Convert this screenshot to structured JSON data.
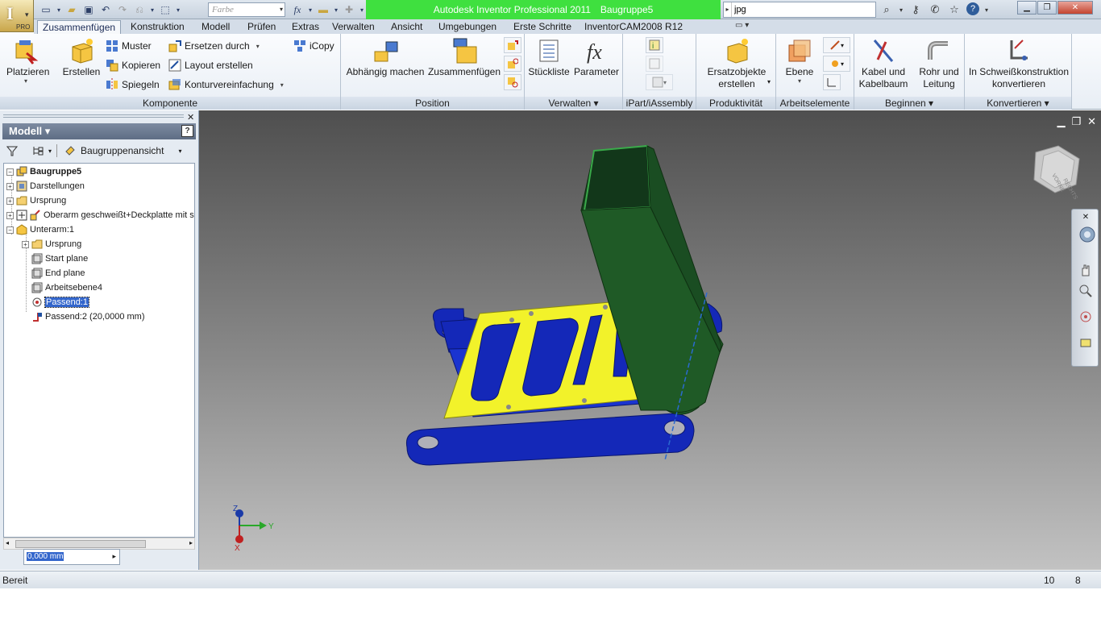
{
  "app": {
    "title": "Autodesk Inventor Professional 2011",
    "document": "Baugruppe5",
    "logo_letter": "I",
    "edition": "PRO"
  },
  "quick_access": {
    "color_combo_value": "Farbe",
    "search_value": "jpg"
  },
  "tabs": [
    {
      "label": "Zusammenfügen",
      "active": true
    },
    {
      "label": "Konstruktion"
    },
    {
      "label": "Modell"
    },
    {
      "label": "Prüfen"
    },
    {
      "label": "Extras"
    },
    {
      "label": "Verwalten"
    },
    {
      "label": "Ansicht"
    },
    {
      "label": "Umgebungen"
    },
    {
      "label": "Erste Schritte"
    },
    {
      "label": "InventorCAM2008 R12"
    }
  ],
  "ribbon": {
    "komponente": {
      "title": "Komponente",
      "platzieren": "Platzieren",
      "erstellen": "Erstellen",
      "muster": "Muster",
      "kopieren": "Kopieren",
      "spiegeln": "Spiegeln",
      "ersetzen": "Ersetzen durch",
      "layout": "Layout erstellen",
      "kontur": "Konturvereinfachung",
      "icopy": "iCopy"
    },
    "position": {
      "title": "Position",
      "abhaengig": "Abhängig machen",
      "zusammenfuegen": "Zusammenfügen"
    },
    "verwalten": {
      "title": "Verwalten",
      "stueckliste": "Stückliste",
      "parameter": "Parameter"
    },
    "ipart": {
      "title": "iPart/iAssembly"
    },
    "produktivitaet": {
      "title": "Produktivität",
      "ersatz_line1": "Ersatzobjekte",
      "ersatz_line2": "erstellen"
    },
    "arbeitselemente": {
      "title": "Arbeitselemente",
      "ebene": "Ebene"
    },
    "beginnen": {
      "title": "Beginnen",
      "kabel_line1": "Kabel und",
      "kabel_line2": "Kabelbaum",
      "rohr_line1": "Rohr und",
      "rohr_line2": "Leitung"
    },
    "konvertieren": {
      "title": "Konvertieren",
      "schweiss_line1": "In Schweißkonstruktion",
      "schweiss_line2": "konvertieren"
    }
  },
  "browser": {
    "header": "Modell",
    "view_label": "Baugruppenansicht",
    "tree": [
      {
        "label": "Baugruppe5",
        "bold": true
      },
      {
        "label": "Darstellungen"
      },
      {
        "label": "Ursprung"
      },
      {
        "label": "Oberarm geschweißt+Deckplatte mit s"
      },
      {
        "label": "Unterarm:1"
      },
      {
        "label": "Ursprung"
      },
      {
        "label": "Start plane"
      },
      {
        "label": "End plane"
      },
      {
        "label": "Arbeitsebene4"
      },
      {
        "label": "Passend:1",
        "selected": true
      },
      {
        "label": "Passend:2 (20,0000 mm)"
      }
    ],
    "offset_value": "0,000 mm"
  },
  "viewcube_labels": [
    "VORNE",
    "RECHTS"
  ],
  "triad": {
    "x": "X",
    "y": "Y",
    "z": "Z"
  },
  "statusbar": {
    "text": "Bereit",
    "n1": "10",
    "n2": "8"
  },
  "colors": {
    "title_green": "#3fe03f",
    "part_blue": "#1428b8",
    "part_yellow": "#f2f22a",
    "part_green": "#1f5a26"
  }
}
